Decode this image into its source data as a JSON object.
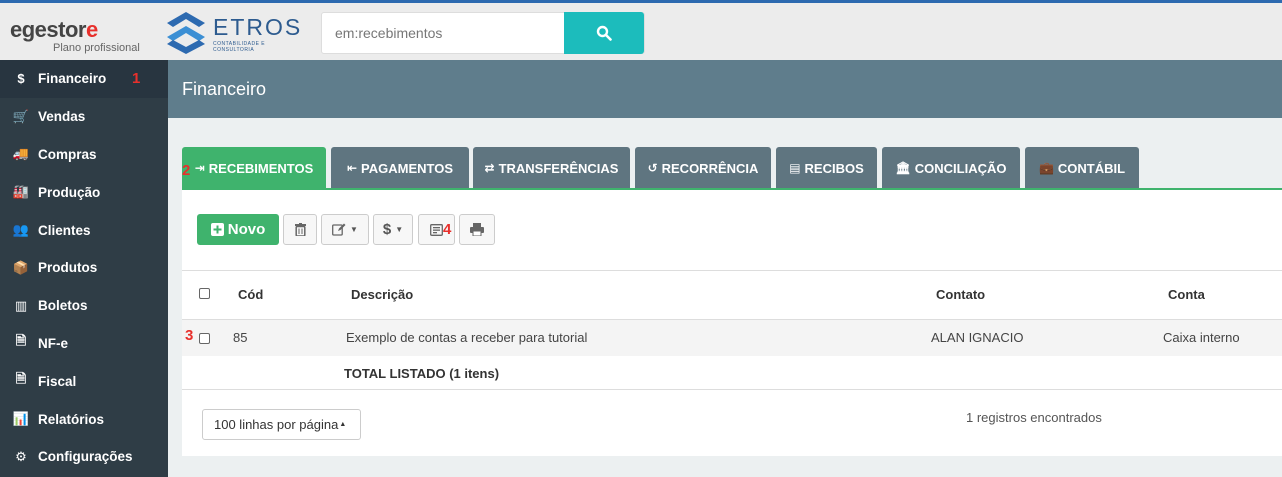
{
  "brand": {
    "egestor_word_a": "egestor",
    "egestor_word_b": "e",
    "egestor_sub": "Plano profissional",
    "partner_name": "ETROS",
    "partner_tag": "CONTABILIDADE E CONSULTORIA"
  },
  "search": {
    "placeholder": "em:recebimentos"
  },
  "sidebar": {
    "items": [
      {
        "label": "Financeiro",
        "icon": "dollar-icon",
        "glyph": "$"
      },
      {
        "label": "Vendas",
        "icon": "cart-icon",
        "glyph": "🛒"
      },
      {
        "label": "Compras",
        "icon": "truck-icon",
        "glyph": "🚚"
      },
      {
        "label": "Produção",
        "icon": "factory-icon",
        "glyph": "🏭"
      },
      {
        "label": "Clientes",
        "icon": "users-icon",
        "glyph": "👥"
      },
      {
        "label": "Produtos",
        "icon": "cubes-icon",
        "glyph": "📦"
      },
      {
        "label": "Boletos",
        "icon": "barcode-icon",
        "glyph": "▥"
      },
      {
        "label": "NF-e",
        "icon": "invoice-icon",
        "glyph": "🗎"
      },
      {
        "label": "Fiscal",
        "icon": "document-icon",
        "glyph": "🗎"
      },
      {
        "label": "Relatórios",
        "icon": "bar-chart-icon",
        "glyph": "📊"
      },
      {
        "label": "Configurações",
        "icon": "gear-icon",
        "glyph": "⚙"
      }
    ],
    "marker": "1"
  },
  "header": {
    "title": "Financeiro"
  },
  "tabs": [
    {
      "label": "RECEBIMENTOS",
      "glyph": "⇥"
    },
    {
      "label": "PAGAMENTOS",
      "glyph": "⇤"
    },
    {
      "label": "TRANSFERÊNCIAS",
      "glyph": "⇄"
    },
    {
      "label": "RECORRÊNCIA",
      "glyph": "↺"
    },
    {
      "label": "RECIBOS",
      "glyph": "▤"
    },
    {
      "label": "CONCILIAÇÃO",
      "glyph": "🏛"
    },
    {
      "label": "CONTÁBIL",
      "glyph": "💼"
    }
  ],
  "markers": {
    "tabs": "2",
    "row": "3",
    "toolbar": "4"
  },
  "toolbar": {
    "new_label": "Novo"
  },
  "table": {
    "columns": [
      "Cód",
      "Descrição",
      "Contato",
      "Conta"
    ],
    "rows": [
      {
        "code": "85",
        "description": "Exemplo de contas a receber para tutorial",
        "contact": "ALAN IGNACIO",
        "account": "Caixa interno"
      }
    ],
    "total": "TOTAL LISTADO (1 itens)"
  },
  "footer": {
    "per_page": "100 linhas por página",
    "found": "1 registros encontrados"
  },
  "colors": {
    "accent_green": "#3fb36d",
    "sidebar_bg": "#2f3d46",
    "header_bg": "#5f7d8c",
    "search_button": "#1cbcbc",
    "marker_red": "#e8302c"
  }
}
